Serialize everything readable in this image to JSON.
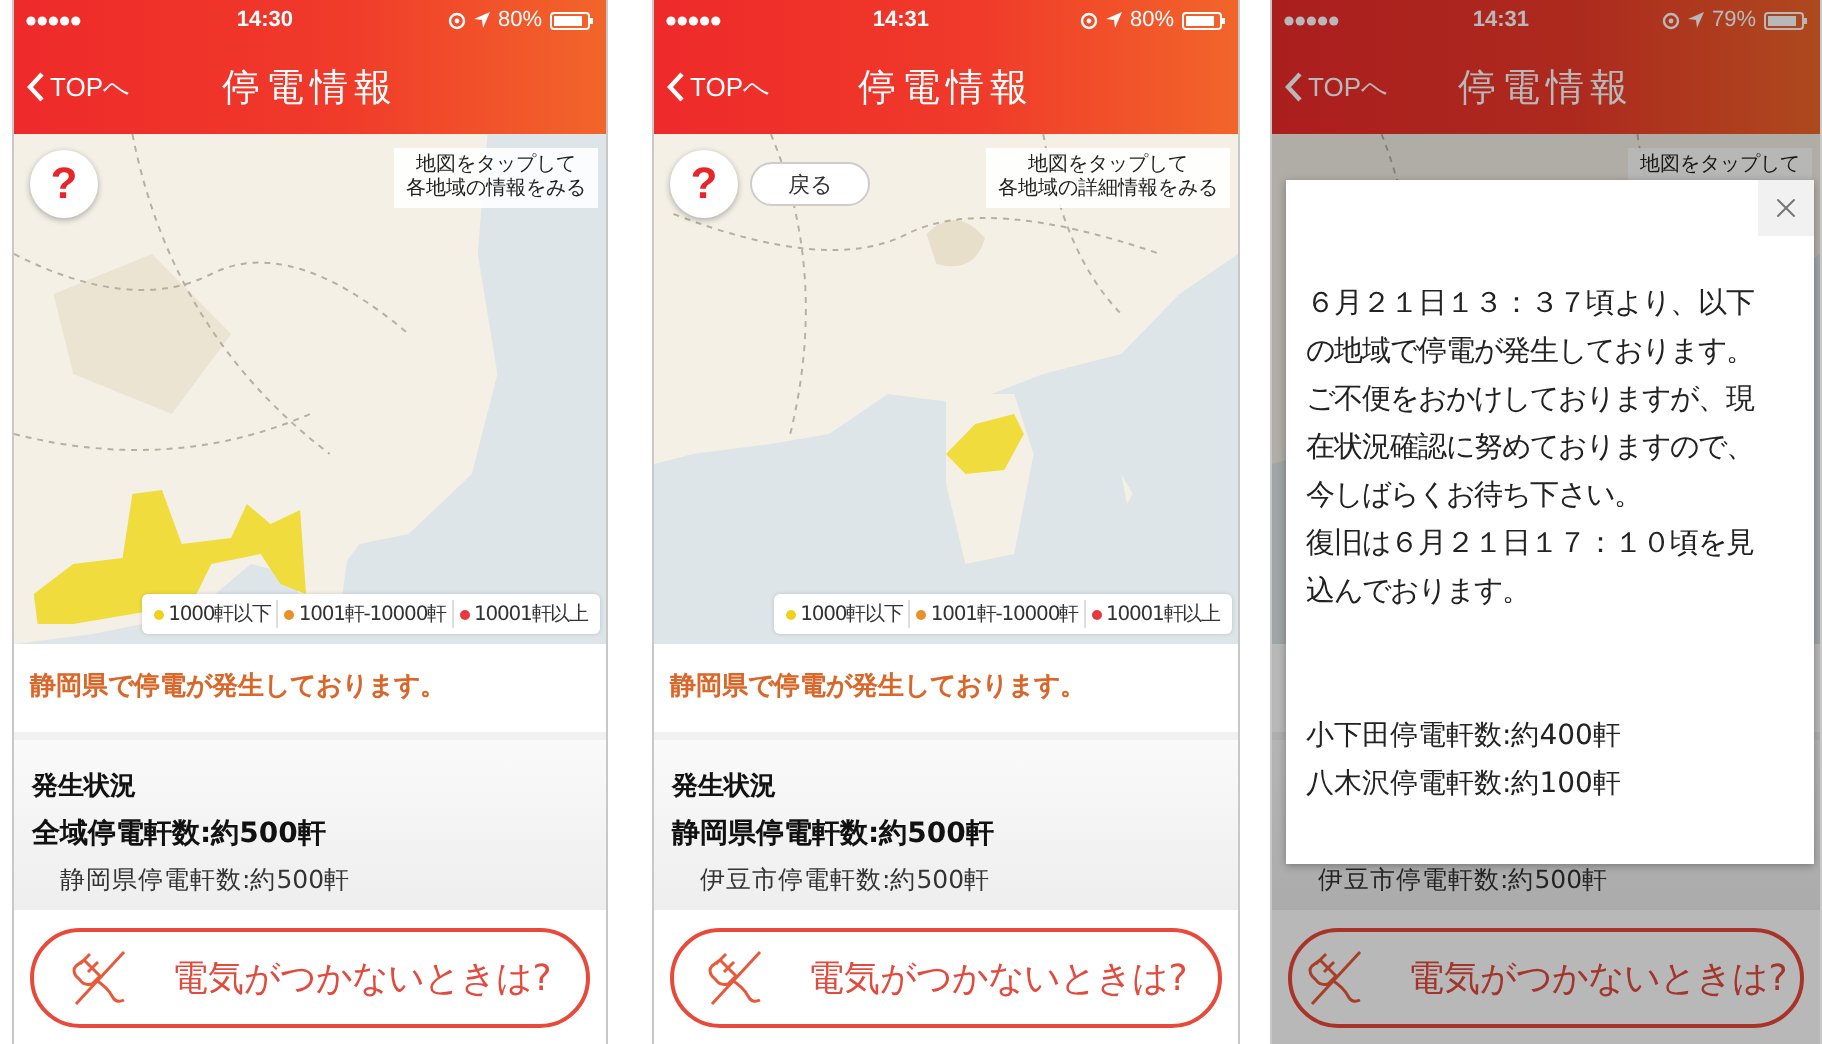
{
  "phones": [
    {
      "status_bar": {
        "time": "14:30",
        "battery": "80%"
      },
      "header": {
        "back": "TOPへ",
        "title": "停電情報"
      },
      "map": {
        "kind": "picture",
        "help": "?",
        "hint": [
          "地図をタップして",
          "各地域の情報をみる"
        ],
        "legend": [
          {
            "label": "1000軒以下",
            "color": "#f0d21c"
          },
          {
            "label": "1001軒-10000軒",
            "color": "#e8912b"
          },
          {
            "label": "10001軒以上",
            "color": "#e83a3c"
          }
        ]
      },
      "alert": "静岡県で停電が発生しております。",
      "situation": {
        "heading": "発生状況",
        "total": "全域停電軒数:約500軒",
        "detail": "静岡県停電軒数:約500軒"
      },
      "action": "電気がつかないときは?"
    },
    {
      "status_bar": {
        "time": "14:31",
        "battery": "80%"
      },
      "header": {
        "back": "TOPへ",
        "title": "停電情報"
      },
      "map": {
        "kind": "picture",
        "help": "?",
        "back_button": "戻る",
        "hint": [
          "地図をタップして",
          "各地域の詳細情報をみる"
        ],
        "legend": [
          {
            "label": "1000軒以下",
            "color": "#f0d21c"
          },
          {
            "label": "1001軒-10000軒",
            "color": "#e8912b"
          },
          {
            "label": "10001軒以上",
            "color": "#e83a3c"
          }
        ]
      },
      "alert": "静岡県で停電が発生しております。",
      "situation": {
        "heading": "発生状況",
        "total": "静岡県停電軒数:約500軒",
        "detail": "伊豆市停電軒数:約500軒"
      },
      "action": "電気がつかないときは?"
    },
    {
      "status_bar": {
        "time": "14:31",
        "battery": "79%"
      },
      "header": {
        "back": "TOPへ",
        "title": "停電情報"
      },
      "map": {
        "kind": "picture",
        "hint": [
          "地図をタップして"
        ]
      },
      "situation": {
        "detail": "伊豆市停電軒数:約500軒"
      },
      "action": "電気がつかないときは?",
      "dialog": {
        "message": [
          "６月２１日１３：３７頃より、以下の地域で停電が発生しております。ご不便をおかけしておりますが、現在状況確認に努めておりますので、今しばらくお待ち下さい。",
          "復旧は６月２１日１７：１０頃を見込んでおります。"
        ],
        "details": [
          "小下田停電軒数:約400軒",
          "八木沢停電軒数:約100軒"
        ]
      }
    }
  ]
}
